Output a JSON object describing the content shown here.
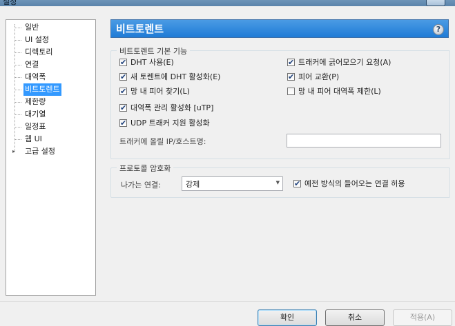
{
  "window": {
    "title": "설정"
  },
  "sidebar": {
    "items": [
      {
        "label": "일반"
      },
      {
        "label": "UI 설정"
      },
      {
        "label": "디렉토리"
      },
      {
        "label": "연결"
      },
      {
        "label": "대역폭"
      },
      {
        "label": "비트토렌트",
        "selected": true
      },
      {
        "label": "제한량"
      },
      {
        "label": "대기열"
      },
      {
        "label": "일정표"
      },
      {
        "label": "웹 UI"
      },
      {
        "label": "고급 설정",
        "expandable": true
      }
    ]
  },
  "header": {
    "title": "비트토렌트",
    "help": "?"
  },
  "basic": {
    "legend": "비트토렌트 기본 기능",
    "dht": "DHT 사용(E)",
    "dht_new": "새 토렌트에 DHT 활성화(E)",
    "lpd": "망 내 피어 찾기(L)",
    "bw_mgmt": "대역폭 관리 활성화 [uTP]",
    "udp": "UDP 트래커 지원 활성화",
    "scrape": "트래커에 긁어모으기 요청(A)",
    "pex": "피어 교환(P)",
    "lan_limit": "망 내 피어 대역폭 제한(L)",
    "ip_label": "트래커에 올릴 IP/호스트명:",
    "ip_value": ""
  },
  "encryption": {
    "legend": "프로토콜 암호화",
    "outgoing_label": "나가는 연결:",
    "outgoing_value": "강제",
    "legacy": "예전 방식의 들어오는 연결 허용"
  },
  "buttons": {
    "ok": "확인",
    "cancel": "취소",
    "apply": "적용(A)"
  }
}
